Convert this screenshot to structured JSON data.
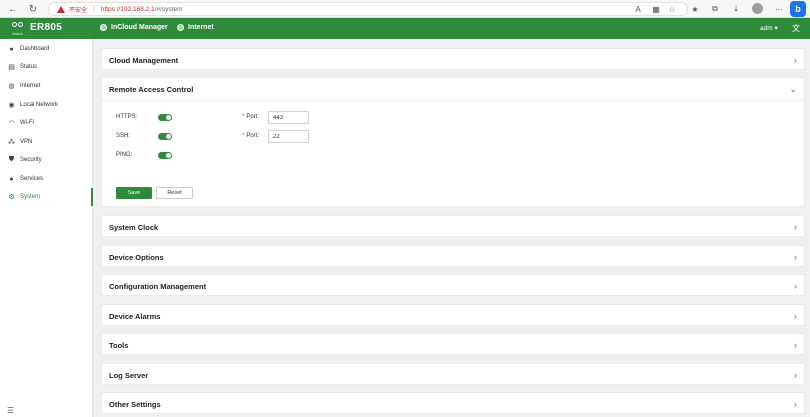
{
  "browser": {
    "insecure_label": "不安全",
    "url_host": "https://192.168.2.1",
    "url_rest": "/#/system"
  },
  "app": {
    "logo_text": "ER805",
    "logo_sub": "inhand",
    "nav": [
      "InCloud Manager",
      "Internet"
    ],
    "user": "adm ▾",
    "accent": "#2e8b3a"
  },
  "sidebar": {
    "items": [
      {
        "label": "Dashboard",
        "icon": "dashboard-icon"
      },
      {
        "label": "Status",
        "icon": "status-icon"
      },
      {
        "label": "Internet",
        "icon": "globe-icon"
      },
      {
        "label": "Local Network",
        "icon": "network-icon"
      },
      {
        "label": "Wi-Fi",
        "icon": "wifi-icon"
      },
      {
        "label": "VPN",
        "icon": "vpn-icon"
      },
      {
        "label": "Security",
        "icon": "shield-icon"
      },
      {
        "label": "Services",
        "icon": "services-icon"
      },
      {
        "label": "System",
        "icon": "gear-icon"
      }
    ],
    "active": "System"
  },
  "panels": {
    "cloud": "Cloud Management",
    "rac": "Remote Access Control",
    "system_clock": "System Clock",
    "device_options": "Device Options",
    "config_mgmt": "Configuration Management",
    "device_alarms": "Device Alarms",
    "tools": "Tools",
    "log_server": "Log Server",
    "other": "Other Settings"
  },
  "rac": {
    "https_label": "HTTPS:",
    "ssh_label": "SSH:",
    "ping_label": "PING:",
    "port_label": "Port:",
    "required_mark": "*",
    "https_port": "443",
    "ssh_port": "22",
    "https_enabled": true,
    "ssh_enabled": true,
    "ping_enabled": true,
    "save_label": "Save",
    "reset_label": "Reset"
  }
}
